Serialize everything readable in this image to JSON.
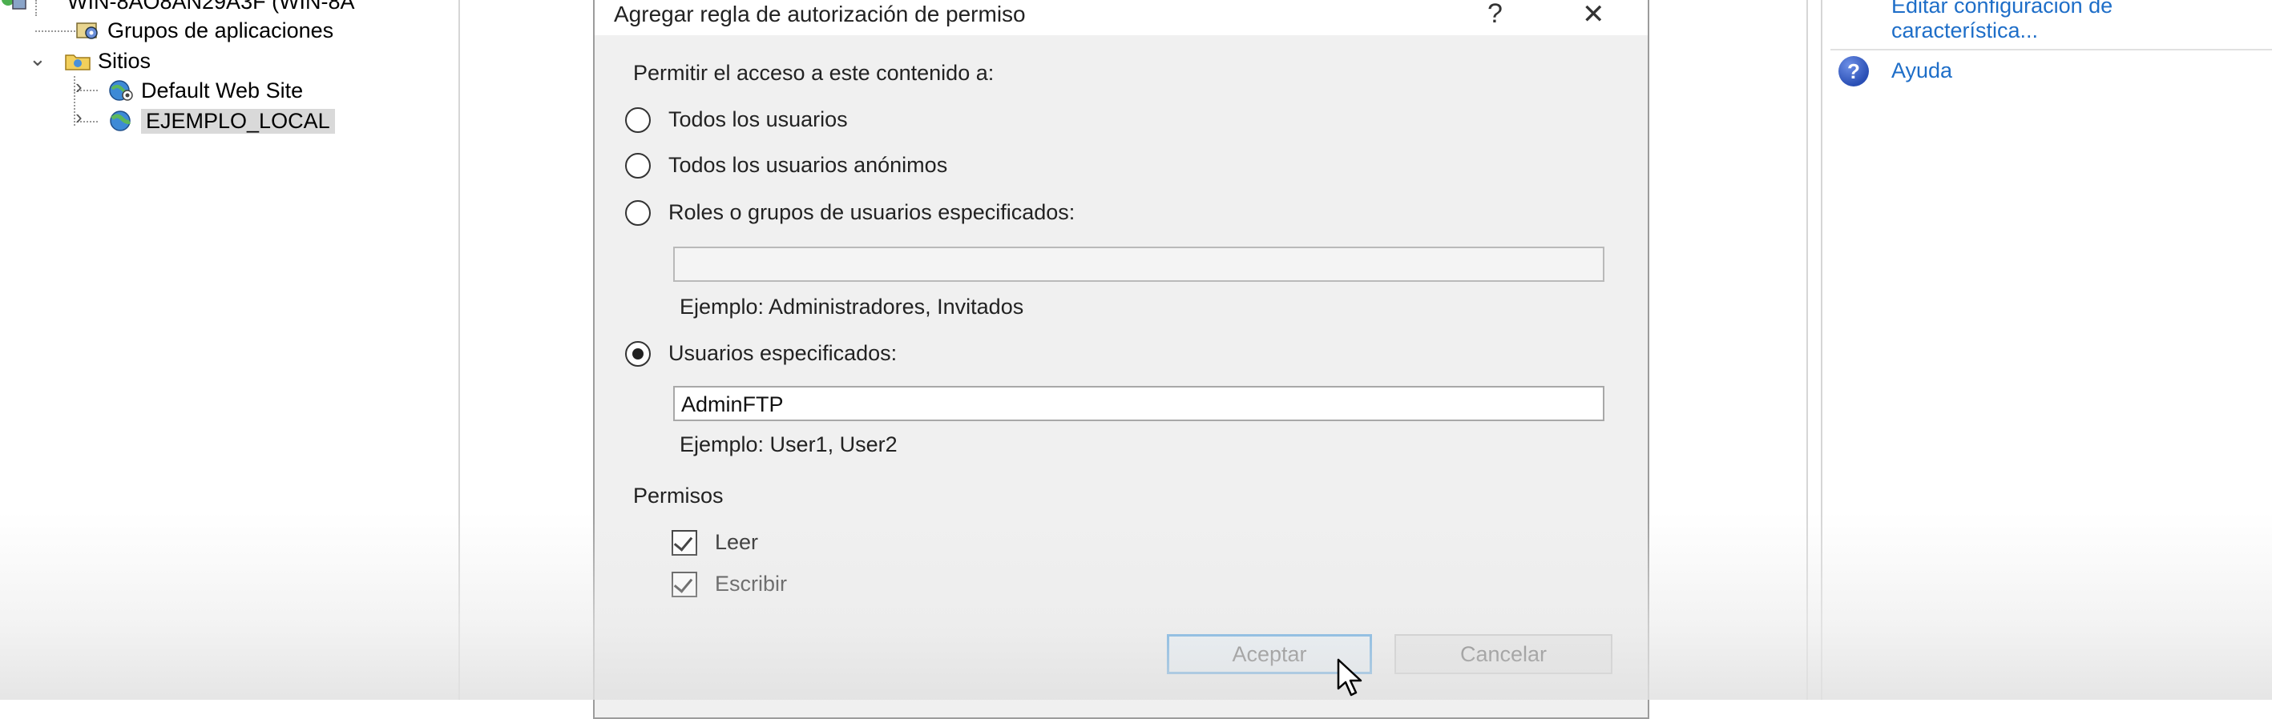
{
  "tree": {
    "server_node": "WIN-8AO8AN29A3F (WIN-8A",
    "app_pools": "Grupos de aplicaciones",
    "sites": "Sitios",
    "site_default": "Default Web Site",
    "site_local": "EJEMPLO_LOCAL"
  },
  "actions": {
    "edit_feature_line1": "Editar configuración de",
    "edit_feature_line2": "característica...",
    "help": "Ayuda"
  },
  "dialog": {
    "title": "Agregar regla de autorización de permiso",
    "help_btn": "?",
    "close_btn": "✕",
    "access_label": "Permitir el acceso a este contenido a:",
    "opt_all_users": "Todos los usuarios",
    "opt_anonymous": "Todos los usuarios anónimos",
    "opt_roles": "Roles o grupos de usuarios especificados:",
    "roles_value": "",
    "roles_example": "Ejemplo: Administradores, Invitados",
    "opt_users": "Usuarios especificados:",
    "users_value": "AdminFTP",
    "users_example": "Ejemplo: User1, User2",
    "permissions_label": "Permisos",
    "perm_read": "Leer",
    "perm_write": "Escribir",
    "ok_button": "Aceptar",
    "cancel_button": "Cancelar",
    "selected_option": "opt_users",
    "perm_read_checked": true,
    "perm_write_checked": true
  },
  "colors": {
    "link": "#1e6ec8",
    "primary_button_border": "#0078d7",
    "selection": "#d9d9d9"
  }
}
